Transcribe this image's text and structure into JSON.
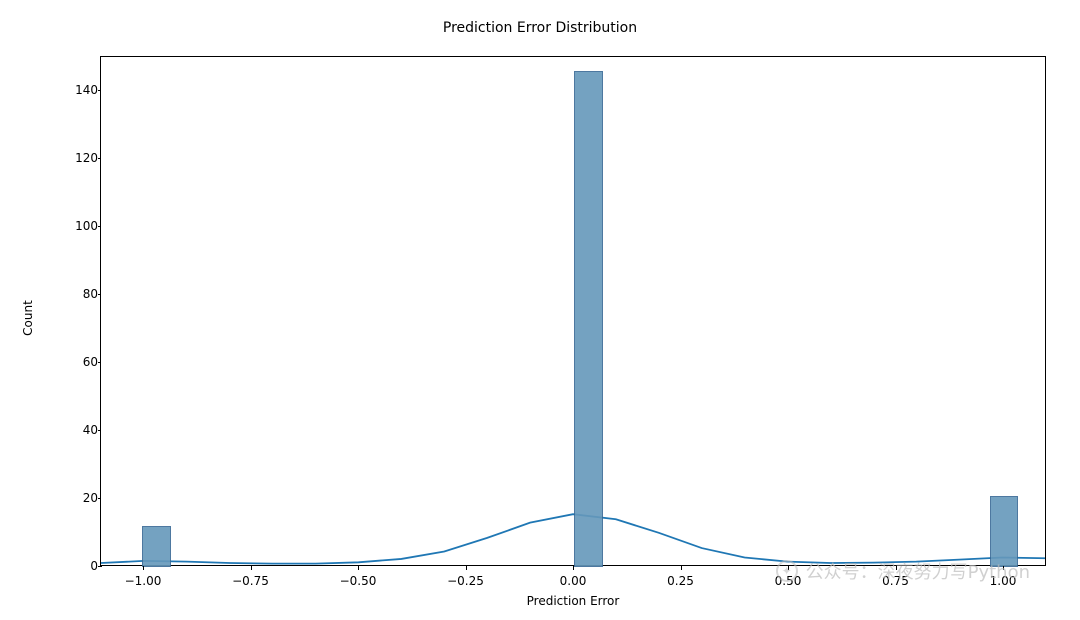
{
  "chart_data": {
    "type": "histogram_kde",
    "title": "Prediction Error Distribution",
    "xlabel": "Prediction Error",
    "ylabel": "Count",
    "xlim": [
      -1.1,
      1.1
    ],
    "ylim": [
      0,
      150
    ],
    "x_ticks": [
      -1.0,
      -0.75,
      -0.5,
      -0.25,
      0.0,
      0.25,
      0.5,
      0.75,
      1.0
    ],
    "x_tick_labels": [
      "−1.00",
      "−0.75",
      "−0.50",
      "−0.25",
      "0.00",
      "0.25",
      "0.50",
      "0.75",
      "1.00"
    ],
    "y_ticks": [
      0,
      20,
      40,
      60,
      80,
      100,
      120,
      140
    ],
    "y_tick_labels": [
      "0",
      "20",
      "40",
      "60",
      "80",
      "100",
      "120",
      "140"
    ],
    "bars": [
      {
        "x_center": -0.97,
        "count": 12,
        "width": 0.067
      },
      {
        "x_center": 0.033,
        "count": 146,
        "width": 0.067
      },
      {
        "x_center": 1.0,
        "count": 21,
        "width": 0.067
      }
    ],
    "kde_points": [
      {
        "x": -1.1,
        "y": 0.6
      },
      {
        "x": -1.0,
        "y": 1.2
      },
      {
        "x": -0.9,
        "y": 1.0
      },
      {
        "x": -0.8,
        "y": 0.6
      },
      {
        "x": -0.7,
        "y": 0.4
      },
      {
        "x": -0.6,
        "y": 0.4
      },
      {
        "x": -0.5,
        "y": 0.8
      },
      {
        "x": -0.4,
        "y": 1.8
      },
      {
        "x": -0.3,
        "y": 4.0
      },
      {
        "x": -0.2,
        "y": 8.0
      },
      {
        "x": -0.1,
        "y": 12.5
      },
      {
        "x": 0.0,
        "y": 15.0
      },
      {
        "x": 0.1,
        "y": 13.5
      },
      {
        "x": 0.2,
        "y": 9.5
      },
      {
        "x": 0.3,
        "y": 5.0
      },
      {
        "x": 0.4,
        "y": 2.2
      },
      {
        "x": 0.5,
        "y": 1.0
      },
      {
        "x": 0.6,
        "y": 0.6
      },
      {
        "x": 0.7,
        "y": 0.7
      },
      {
        "x": 0.8,
        "y": 1.0
      },
      {
        "x": 0.9,
        "y": 1.6
      },
      {
        "x": 1.0,
        "y": 2.2
      },
      {
        "x": 1.1,
        "y": 2.0
      }
    ],
    "bar_color": "#6699bb",
    "bar_edge_color": "#3a6a96",
    "kde_color": "#1f77b4"
  },
  "watermark": {
    "text": "公众号：深夜努力写Python",
    "icon": "wechat-icon"
  }
}
